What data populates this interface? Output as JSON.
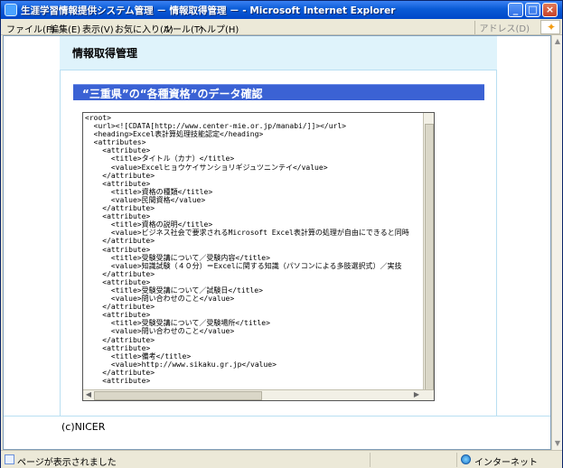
{
  "window": {
    "title": "生涯学習情報提供システム管理 － 情報取得管理 － - Microsoft Internet Explorer",
    "minimize": "_",
    "maximize": "□",
    "close": "×"
  },
  "menubar": {
    "items": [
      "ファイル(F)",
      "編集(E)",
      "表示(V)",
      "お気に入り(A)",
      "ツール(T)",
      "ヘルプ(H)"
    ],
    "address_label": "アドレス(D)"
  },
  "page": {
    "title": "情報取得管理",
    "section_title": "“三重県”の“各種資格”のデータ確認",
    "xml_content": "<root>\n  <url><![CDATA[http://www.center-mie.or.jp/manabi/]]></url>\n  <heading>Excel表計算処理技能認定</heading>\n  <attributes>\n    <attribute>\n      <title>タイトル（カナ）</title>\n      <value>Excelヒョウケイサンショリギジュツニンテイ</value>\n    </attribute>\n    <attribute>\n      <title>資格の種類</title>\n      <value>民間資格</value>\n    </attribute>\n    <attribute>\n      <title>資格の説明</title>\n      <value>ビジネス社会で要求されるMicrosoft Excel表計算の処理が自由にできると同時\n    </attribute>\n    <attribute>\n      <title>受験受講について／受験内容</title>\n      <value>知識試験（４０分）＝Excelに関する知識（パソコンによる多肢選択式）／実技\n    </attribute>\n    <attribute>\n      <title>受験受講について／試験日</title>\n      <value>問い合わせのこと</value>\n    </attribute>\n    <attribute>\n      <title>受験受講について／受験場所</title>\n      <value>問い合わせのこと</value>\n    </attribute>\n    <attribute>\n      <title>備考</title>\n      <value>http://www.sikaku.gr.jp</value>\n    </attribute>\n    <attribute>\n      <title>問い合わせ先／名称</title>",
    "copyright": "(c)NICER"
  },
  "statusbar": {
    "text": "ページが表示されました",
    "zone": "インターネット"
  }
}
